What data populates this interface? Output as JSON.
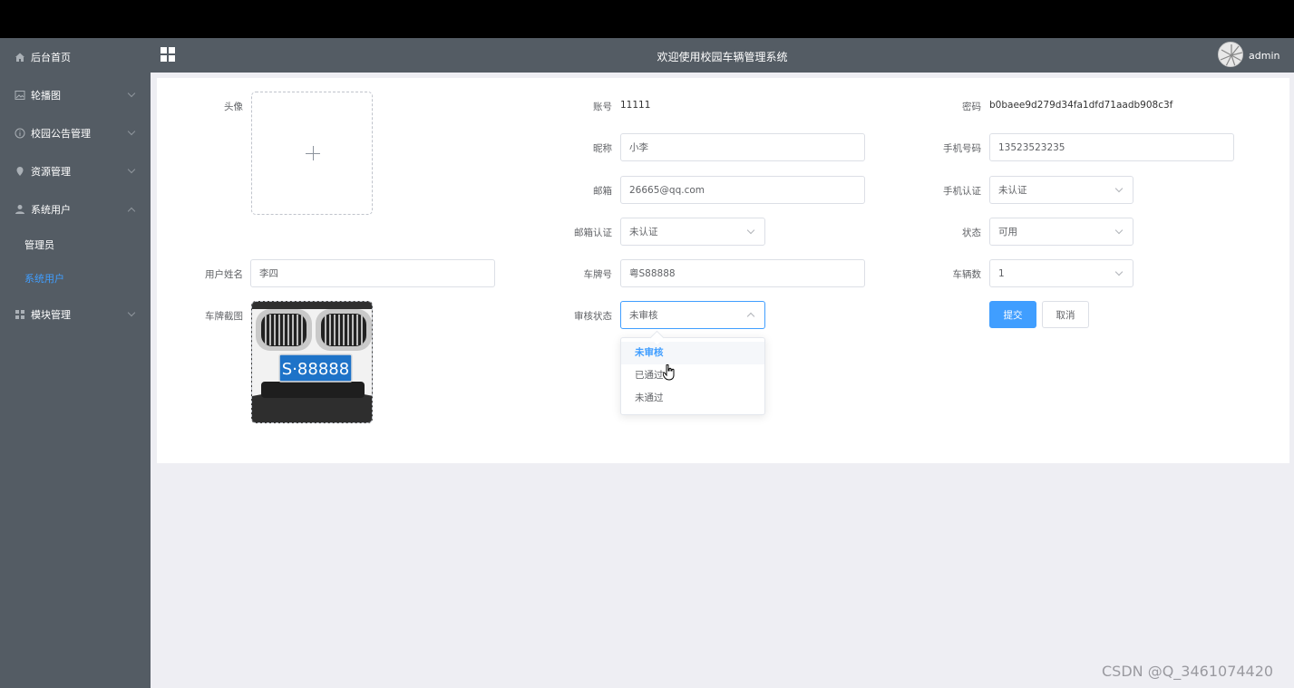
{
  "header": {
    "title": "欢迎使用校园车辆管理系统",
    "username": "admin"
  },
  "sidebar": {
    "items": [
      {
        "label": "后台首页",
        "icon": "home-icon"
      },
      {
        "label": "轮播图",
        "icon": "picture-icon"
      },
      {
        "label": "校园公告管理",
        "icon": "info-icon"
      },
      {
        "label": "资源管理",
        "icon": "location-icon"
      },
      {
        "label": "系统用户",
        "icon": "user-icon",
        "expanded": true
      },
      {
        "label": "模块管理",
        "icon": "grid-icon"
      }
    ],
    "subitems": [
      {
        "label": "管理员"
      },
      {
        "label": "系统用户",
        "active": true
      }
    ]
  },
  "form": {
    "avatar_label": "头像",
    "account_label": "账号",
    "account_value": "11111",
    "password_label": "密码",
    "password_value": "b0baee9d279d34fa1dfd71aadb908c3f",
    "nickname_label": "昵称",
    "nickname_value": "小李",
    "phone_label": "手机号码",
    "phone_value": "13523523235",
    "email_label": "邮箱",
    "email_value": "26665@qq.com",
    "phone_verify_label": "手机认证",
    "phone_verify_value": "未认证",
    "email_verify_label": "邮箱认证",
    "email_verify_value": "未认证",
    "status_label": "状态",
    "status_value": "可用",
    "realname_label": "用户姓名",
    "realname_value": "李四",
    "plate_label": "车牌号",
    "plate_value": "粤S88888",
    "car_count_label": "车辆数",
    "car_count_value": "1",
    "plate_image_label": "车牌截图",
    "plate_image_text": "S·88888",
    "review_label": "审核状态",
    "review_value": "未审核",
    "review_options": [
      "未审核",
      "已通过",
      "未通过"
    ],
    "submit_label": "提交",
    "cancel_label": "取消"
  },
  "watermark": "CSDN @Q_3461074420",
  "colors": {
    "accent": "#409eff",
    "sidebar": "#545c64",
    "background": "#eeeef3"
  }
}
